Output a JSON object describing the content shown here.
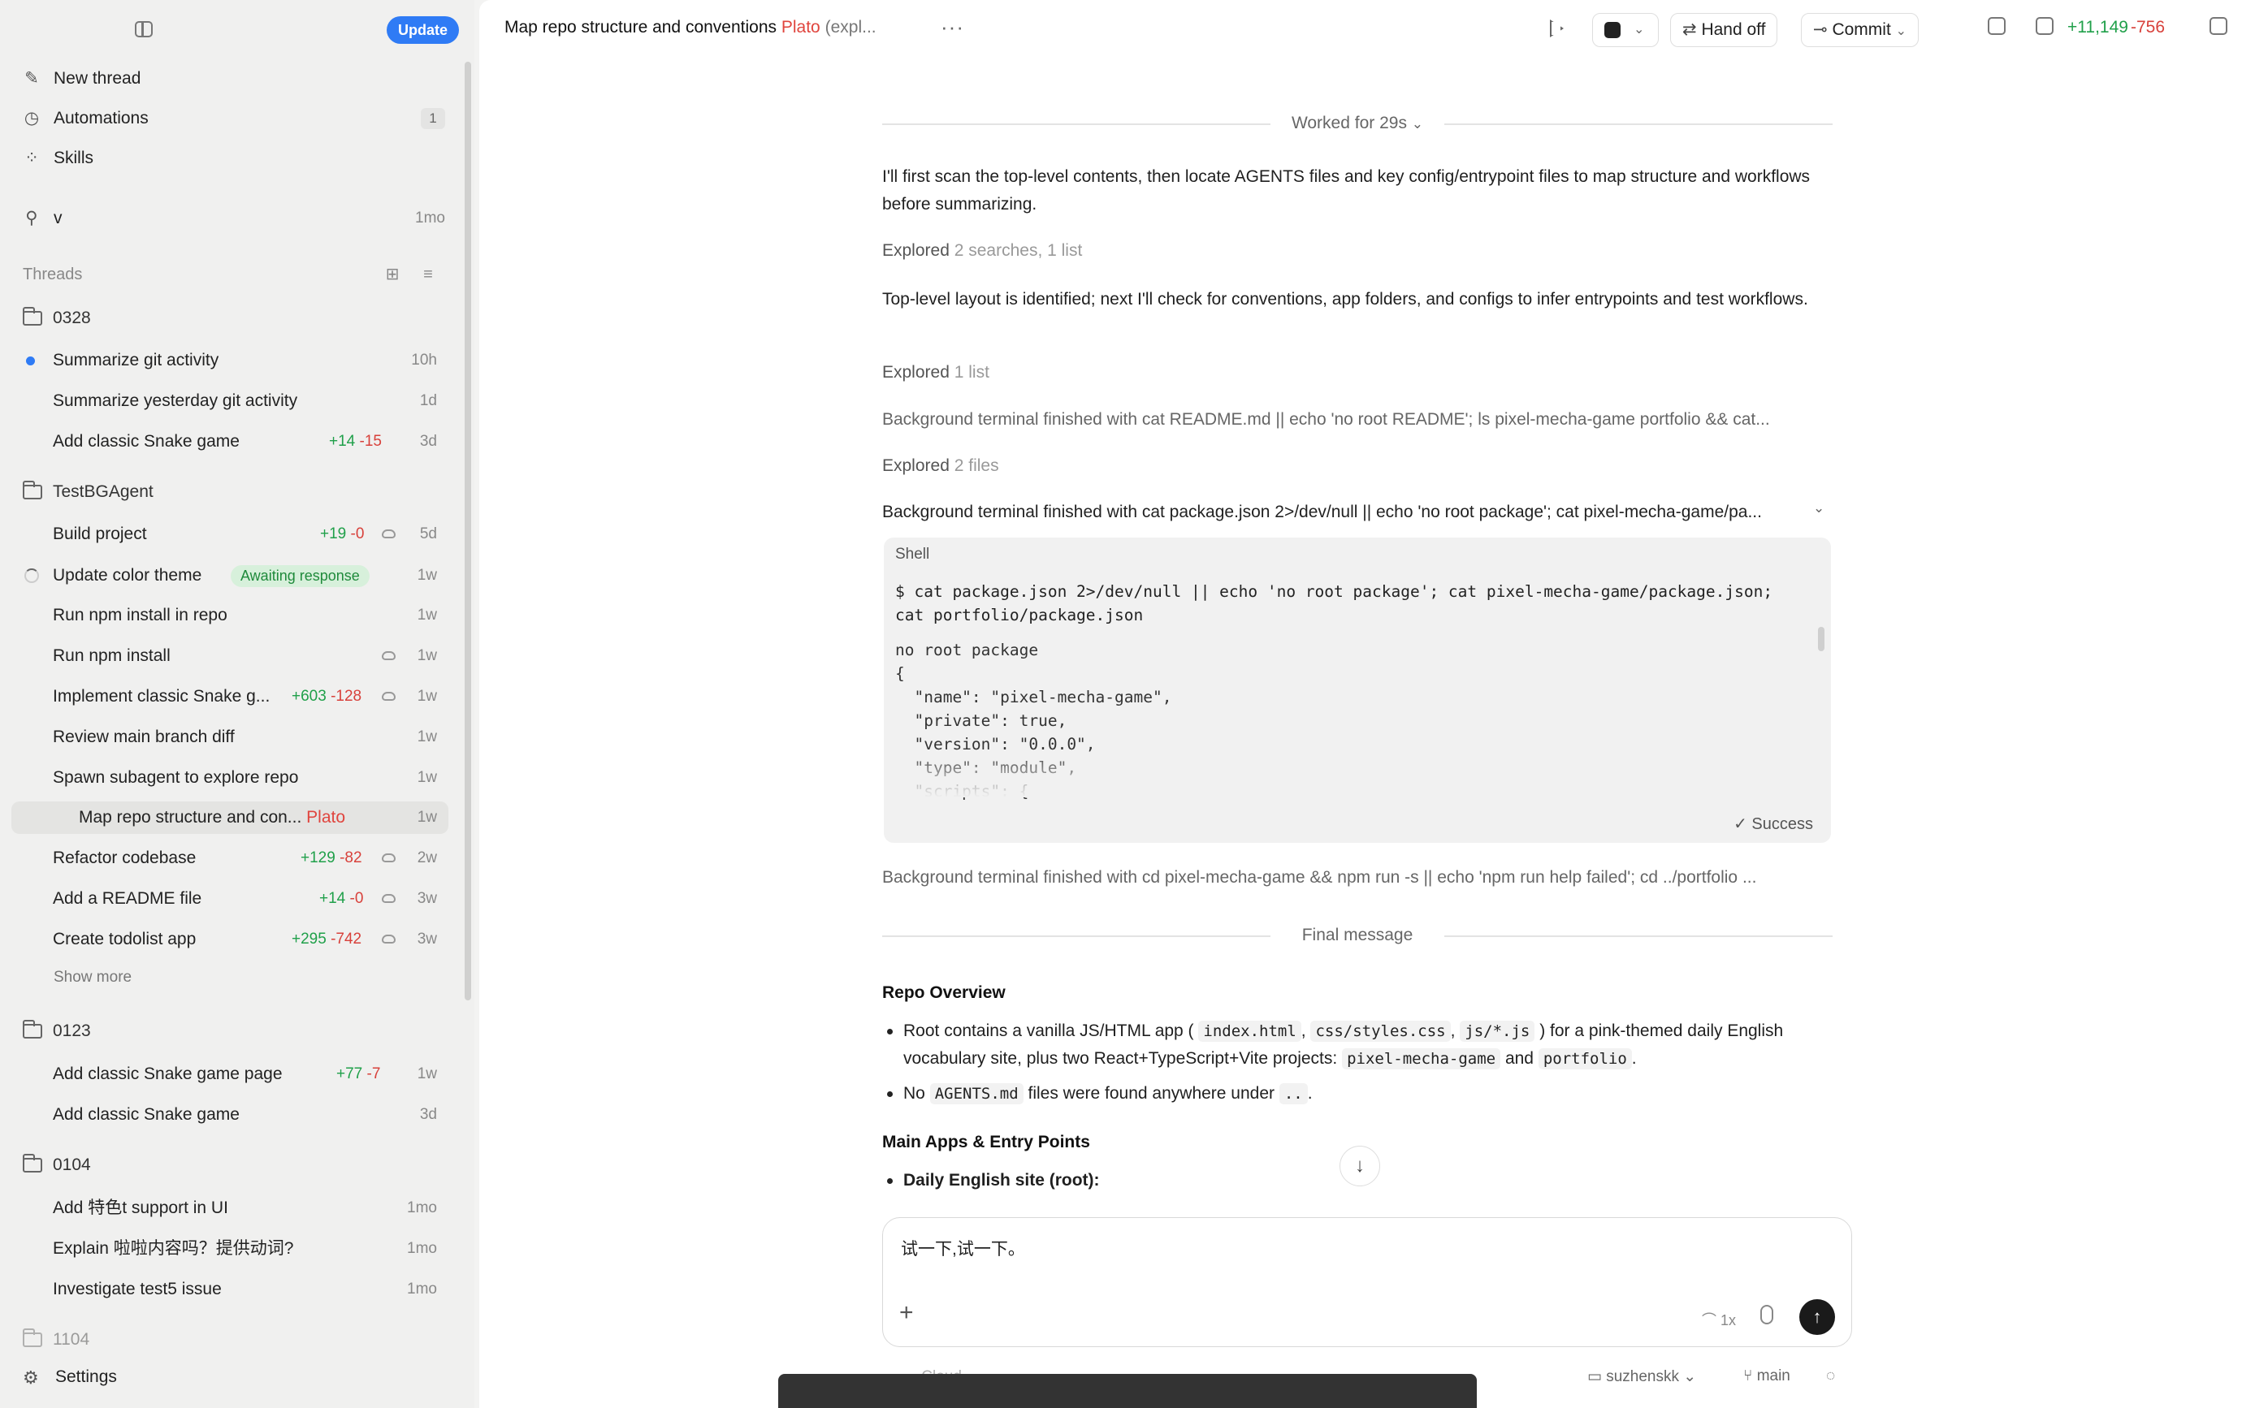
{
  "sidebar": {
    "update_label": "Update",
    "nav": [
      {
        "label": "New thread",
        "icon": "edit-icon"
      },
      {
        "label": "Automations",
        "icon": "clock-icon",
        "count": "1"
      },
      {
        "label": "Skills",
        "icon": "grid-icon"
      }
    ],
    "pinned": {
      "label": "v",
      "time": "1mo"
    },
    "threads_label": "Threads",
    "folders": [
      {
        "name": "0328"
      },
      {
        "name": "TestBGAgent"
      },
      {
        "name": "0123"
      },
      {
        "name": "0104"
      },
      {
        "name": "1104"
      }
    ],
    "items": [
      {
        "title": "Summarize git activity",
        "time": "10h"
      },
      {
        "title": "Summarize yesterday git activity",
        "time": "1d"
      },
      {
        "title": "Add classic Snake game",
        "add": "+14",
        "del": "-15",
        "time": "3d"
      },
      {
        "title": "Build project",
        "add": "+19",
        "del": "-0",
        "time": "5d"
      },
      {
        "title": "Update color theme",
        "status": "Awaiting response",
        "time": "1w"
      },
      {
        "title": "Run npm install in repo",
        "time": "1w"
      },
      {
        "title": "Run npm install",
        "time": "1w"
      },
      {
        "title": "Implement classic Snake g...",
        "add": "+603",
        "del": "-128",
        "time": "1w"
      },
      {
        "title": "Review main branch diff",
        "time": "1w"
      },
      {
        "title": "Spawn subagent to explore repo",
        "time": "1w"
      },
      {
        "title": "Map repo structure and con...",
        "agent": "Plato",
        "time": "1w"
      },
      {
        "title": "Refactor codebase",
        "add": "+129",
        "del": "-82",
        "time": "2w"
      },
      {
        "title": "Add a README file",
        "add": "+14",
        "del": "-0",
        "time": "3w"
      },
      {
        "title": "Create todolist app",
        "add": "+295",
        "del": "-742",
        "time": "3w"
      },
      {
        "title": "Add classic Snake game page",
        "add": "+77",
        "del": "-7",
        "time": "1w"
      },
      {
        "title": "Add classic Snake game",
        "time": "3d"
      },
      {
        "title": "Add 特色t support in UI",
        "time": "1mo"
      },
      {
        "title": "Explain 啦啦内容吗？提供动词?",
        "time": "1mo"
      },
      {
        "title": "Investigate test5 issue",
        "time": "1mo"
      }
    ],
    "show_more": "Show more",
    "settings": "Settings"
  },
  "header": {
    "title": "Map repo structure and conventions",
    "agent": "Plato",
    "suffix": "(expl...",
    "handoff": "Hand off",
    "commit": "Commit",
    "additions": "+11,149",
    "deletions": "-756"
  },
  "conversation": {
    "worked_for": "Worked for 29s",
    "para1": "I'll first scan the top-level contents, then locate AGENTS files and key config/entrypoint files to map structure and workflows before summarizing.",
    "explored1_label": "Explored",
    "explored1_detail": "2 searches, 1 list",
    "para2": "Top-level layout is identified; next I'll check for conventions, app folders, and configs to infer entrypoints and test workflows.",
    "explored2_label": "Explored",
    "explored2_detail": "1 list",
    "bg1": "Background terminal finished with cat README.md || echo 'no root README'; ls pixel-mecha-game portfolio && cat...",
    "explored3_label": "Explored",
    "explored3_detail": "2 files",
    "bg2": "Background terminal finished with cat package.json 2>/dev/null || echo 'no root package'; cat pixel-mecha-game/pa...",
    "shell": {
      "label": "Shell",
      "command": "$ cat package.json 2>/dev/null || echo 'no root package'; cat pixel-mecha-game/package.json;\ncat portfolio/package.json",
      "output": "no root package\n{\n  \"name\": \"pixel-mecha-game\",\n  \"private\": true,\n  \"version\": \"0.0.0\",\n  \"type\": \"module\",\n  \"scripts\": {",
      "status": "✓ Success"
    },
    "bg3": "Background terminal finished with cd pixel-mecha-game && npm run -s || echo 'npm run help failed'; cd ../portfolio ...",
    "final_message": "Final message",
    "h_overview": "Repo Overview",
    "b1_pre": "Root contains a vanilla JS/HTML app (",
    "b1_c1": "index.html",
    "b1_c2": "css/styles.css",
    "b1_c3": "js/*.js",
    "b1_mid": ") for a pink-themed daily English vocabulary site, plus two React+TypeScript+Vite projects:",
    "b1_c4": "pixel-mecha-game",
    "b1_and": "and",
    "b1_c5": "portfolio",
    "b1_end": ".",
    "b2_pre": "No",
    "b2_c1": "AGENTS.md",
    "b2_mid": "files were found anywhere under",
    "b2_c2": "..",
    "b2_end": ".",
    "h_main": "Main Apps & Entry Points",
    "b3": "Daily English site (root):"
  },
  "composer": {
    "text": "试一下,试一下。",
    "speed": "1x"
  },
  "footer": {
    "env": "Cloud",
    "user": "suzhenskk",
    "branch": "main"
  }
}
